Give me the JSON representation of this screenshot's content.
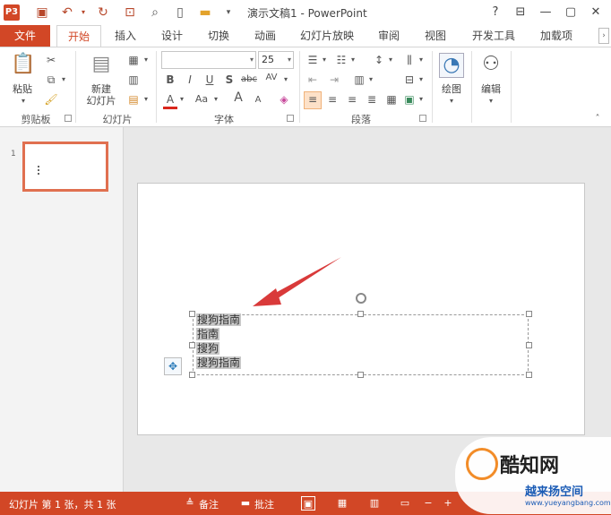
{
  "title_bar": {
    "app_icon": "P3",
    "title": "演示文稿1 - PowerPoint",
    "help": "?",
    "quick_access_icons": [
      "save-icon",
      "undo-icon",
      "redo-icon",
      "present-icon",
      "print-preview-icon",
      "new-icon",
      "open-icon",
      "customize-icon"
    ]
  },
  "tabs": {
    "file": "文件",
    "items": [
      "开始",
      "插入",
      "设计",
      "切换",
      "动画",
      "幻灯片放映",
      "审阅",
      "视图",
      "开发工具",
      "加载项"
    ],
    "active_index": 0
  },
  "ribbon": {
    "clipboard": {
      "paste": "粘贴",
      "label": "剪贴板"
    },
    "slides": {
      "new_slide_line1": "新建",
      "new_slide_line2": "幻灯片",
      "label": "幻灯片"
    },
    "font": {
      "font_name": "",
      "font_size": "25",
      "bold": "B",
      "italic": "I",
      "underline": "U",
      "strike": "S",
      "abc": "abc",
      "spacing": "AV",
      "color_a": "A",
      "case": "Aa",
      "grow": "A",
      "shrink": "A",
      "label": "字体"
    },
    "paragraph": {
      "label": "段落"
    },
    "drawing": {
      "label": "绘图"
    },
    "editing": {
      "label": "编辑"
    }
  },
  "thumbnail": {
    "number": "1"
  },
  "slide": {
    "text_lines": [
      "搜狗指南",
      "指南",
      "搜狗",
      "搜狗指南"
    ]
  },
  "status": {
    "slide_info": "幻灯片 第 1 张，共 1 张",
    "notes": "备注",
    "comments": "批注"
  },
  "watermark": {
    "name": "酷知网",
    "sub": "越来扬空间",
    "url": "www.yueyangbang.com"
  },
  "colors": {
    "accent": "#d24726",
    "arrow": "#d93a3a"
  }
}
